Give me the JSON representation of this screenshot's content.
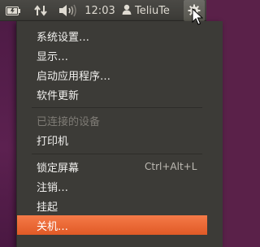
{
  "panel": {
    "clock": "12:03",
    "user": "TeliuTe",
    "icons": [
      "battery-icon",
      "network-transfer-icon",
      "volume-icon",
      "user-icon",
      "session-gear-icon"
    ]
  },
  "menu": {
    "items": [
      {
        "label": "系统设置…",
        "enabled": true
      },
      {
        "label": "显示…",
        "enabled": true
      },
      {
        "label": "启动应用程序…",
        "enabled": true
      },
      {
        "label": "软件更新",
        "enabled": true
      },
      {
        "label": "已连接的设备",
        "enabled": false
      },
      {
        "label": "打印机",
        "enabled": true
      },
      {
        "label": "锁定屏幕",
        "shortcut": "Ctrl+Alt+L",
        "enabled": true
      },
      {
        "label": "注销…",
        "enabled": true
      },
      {
        "label": "挂起",
        "enabled": true
      },
      {
        "label": "关机…",
        "enabled": true,
        "highlighted": true
      }
    ]
  },
  "colors": {
    "panel": "#3c3b37",
    "menu_bg": "#3c3b37",
    "highlight": "#f07746",
    "desktop": "#5a2149"
  }
}
